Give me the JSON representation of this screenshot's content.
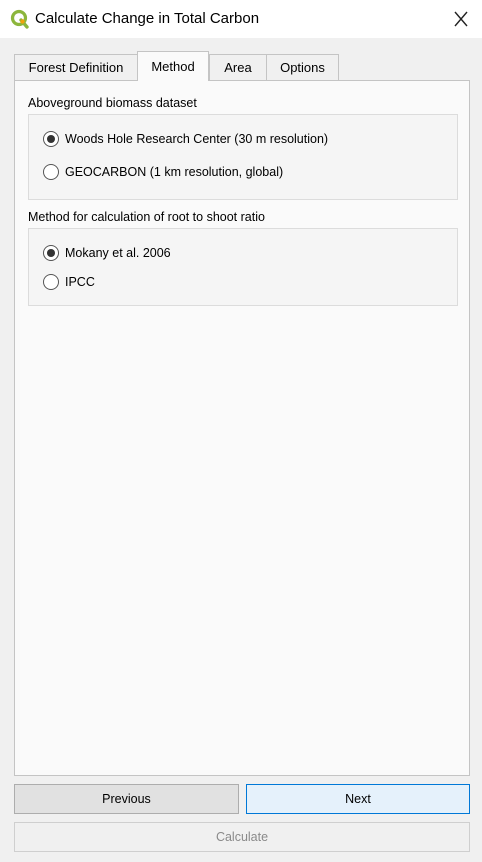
{
  "window": {
    "title": "Calculate Change in Total Carbon",
    "app_icon": "qgis-logo-icon",
    "close_icon": "close-icon",
    "colors": {
      "logo_green": "#8cb63c",
      "logo_yellow": "#f0a30a",
      "default_button_border": "#0078d7"
    }
  },
  "tabs": [
    {
      "label": "Forest Definition",
      "active": false
    },
    {
      "label": "Method",
      "active": true
    },
    {
      "label": "Area",
      "active": false
    },
    {
      "label": "Options",
      "active": false
    }
  ],
  "biomass": {
    "label": "Aboveground biomass dataset",
    "options": [
      {
        "label": "Woods Hole Research Center (30 m resolution)",
        "checked": true
      },
      {
        "label": "GEOCARBON (1 km resolution, global)",
        "checked": false
      }
    ]
  },
  "root_shoot": {
    "label": "Method for calculation of root to shoot ratio",
    "options": [
      {
        "label": "Mokany et al. 2006",
        "checked": true
      },
      {
        "label": "IPCC",
        "checked": false
      }
    ]
  },
  "buttons": {
    "previous": "Previous",
    "next": "Next",
    "calculate": "Calculate"
  }
}
